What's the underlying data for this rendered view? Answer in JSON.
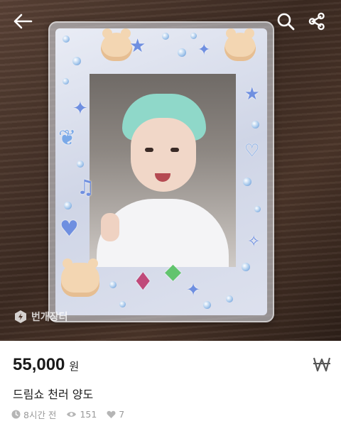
{
  "header": {
    "back_icon": "back-arrow-icon",
    "search_icon": "search-icon",
    "share_icon": "share-icon"
  },
  "photo": {
    "watermark": "번개장터",
    "watermark_icon": "bunjang-logo-icon"
  },
  "listing": {
    "price": "55,000",
    "currency": "원",
    "price_icon": "won-icon",
    "title": "드림쇼 천러 양도",
    "time_ago": "8시간 전",
    "views": "151",
    "likes": "7"
  },
  "colors": {
    "muted_text": "#9a9a9a",
    "text": "#1a1a1a",
    "background": "#ffffff"
  }
}
